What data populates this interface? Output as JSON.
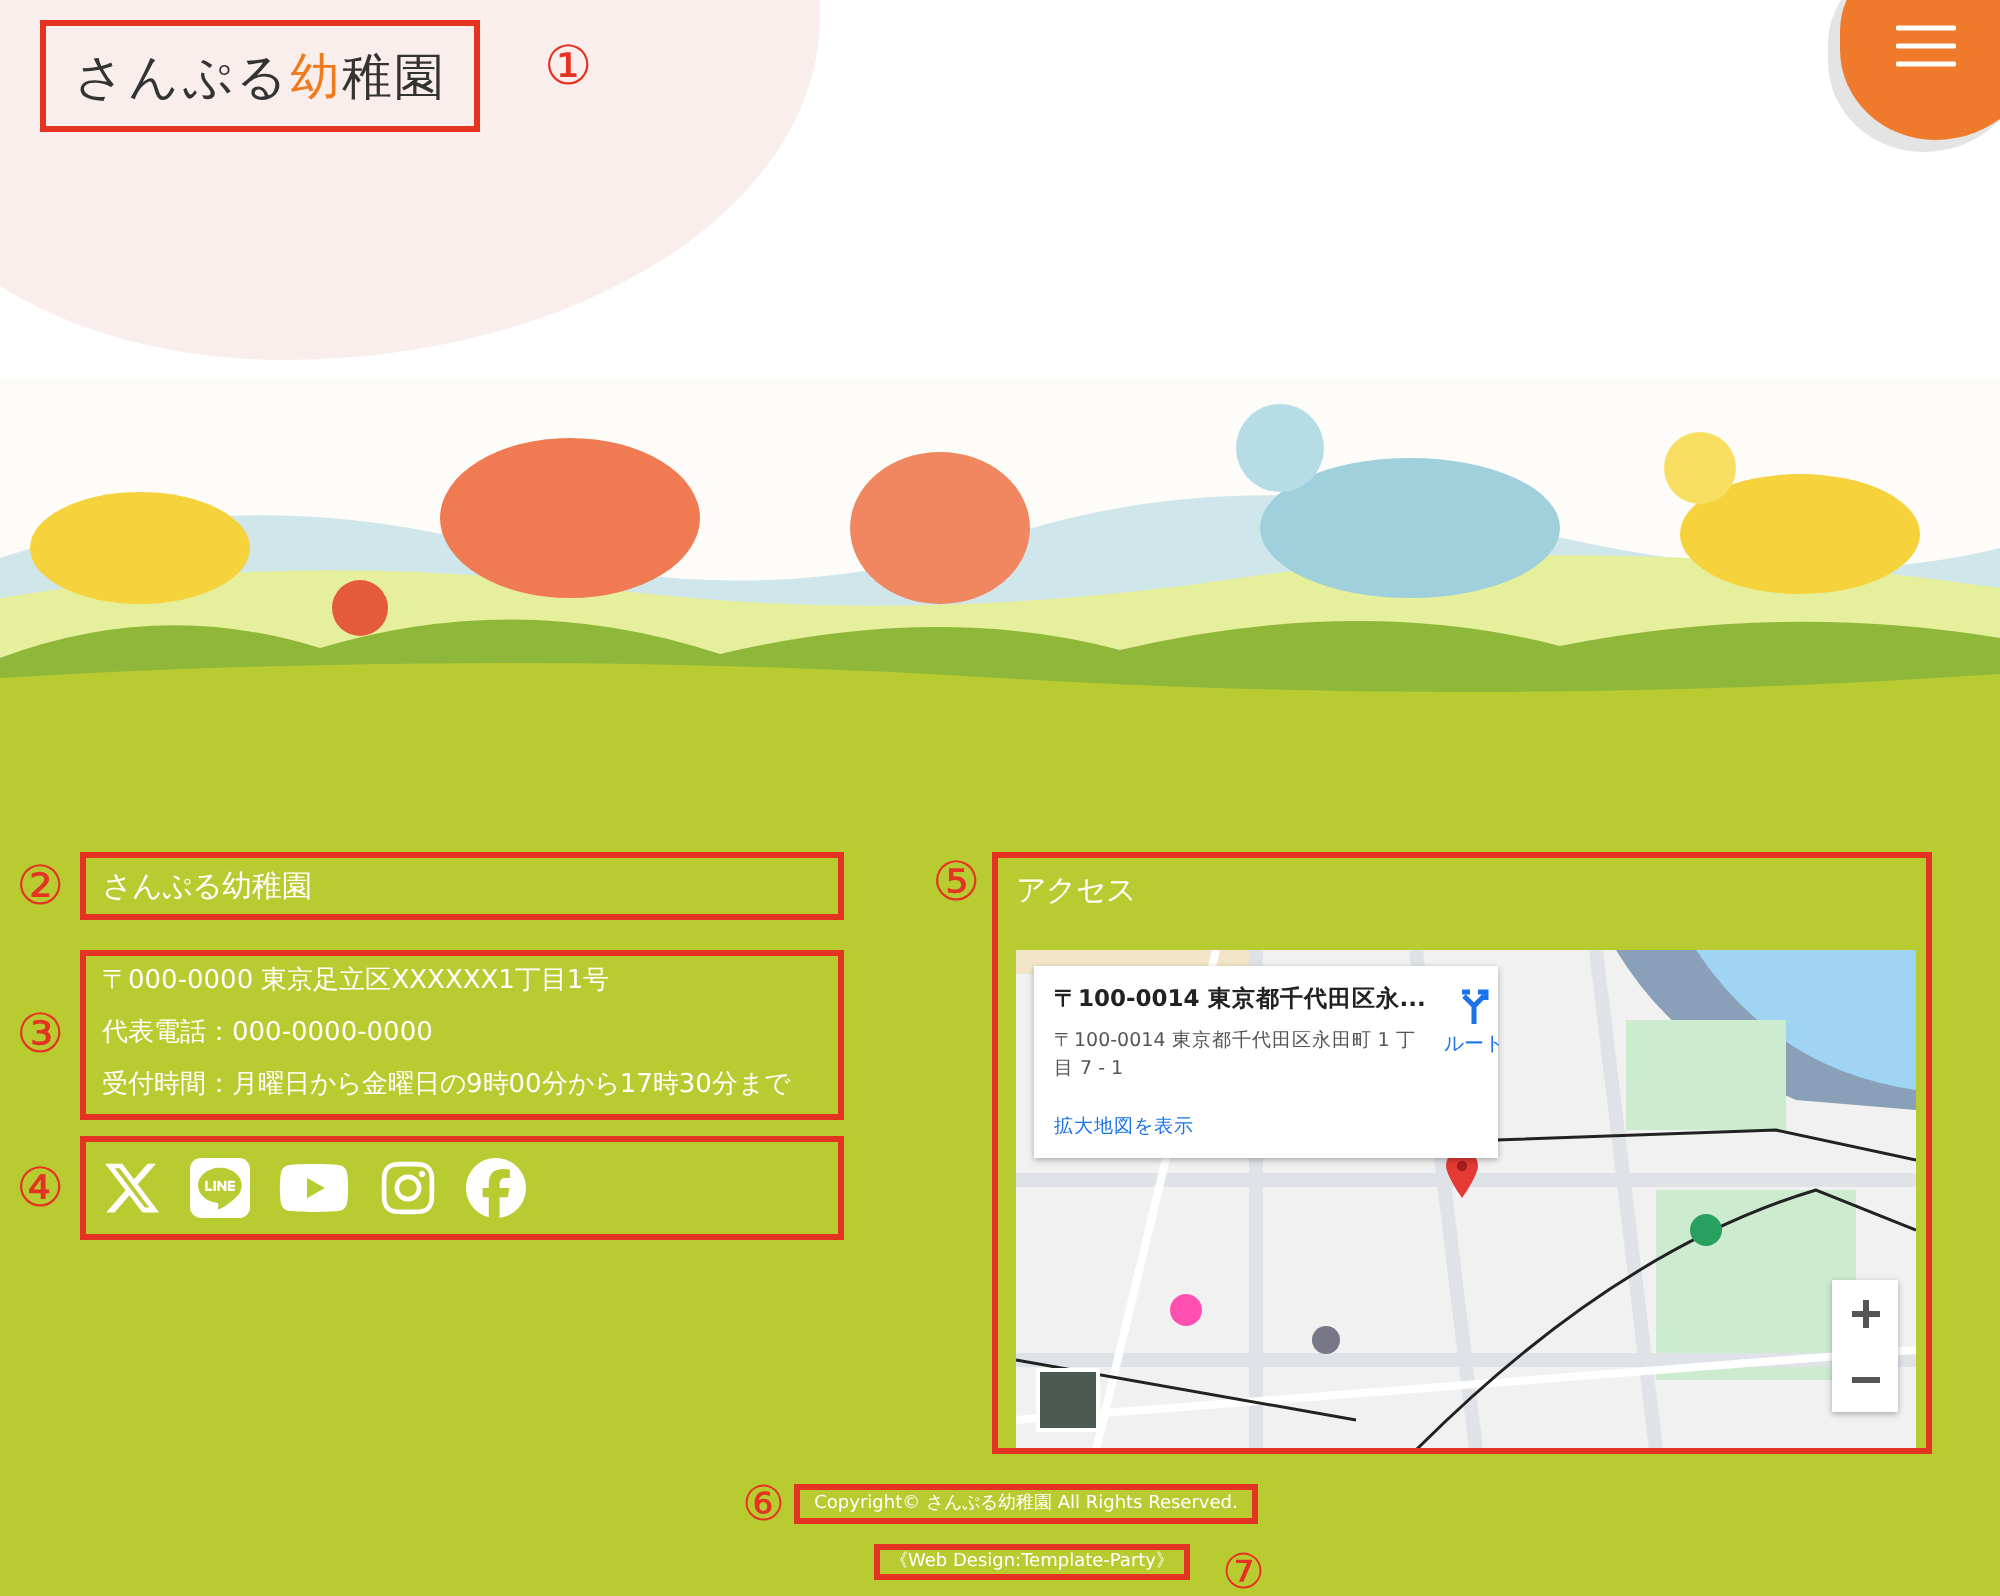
{
  "header": {
    "logo": {
      "before": "さんぷる",
      "accent": "幼",
      "after": "稚園"
    },
    "annotation": "①",
    "menu_button": {
      "kind": "hamburger"
    }
  },
  "school": {
    "name": "さんぷる幼稚園",
    "name_annotation": "②",
    "info_annotation": "③",
    "info_lines": [
      "〒000-0000 東京足立区XXXXXX1丁目1号",
      "代表電話：000-0000-0000",
      "受付時間：月曜日から金曜日の9時00分から17時30分まで"
    ],
    "social_annotation": "④",
    "social": [
      {
        "kind": "x"
      },
      {
        "kind": "line"
      },
      {
        "kind": "youtube"
      },
      {
        "kind": "instagram"
      },
      {
        "kind": "facebook"
      }
    ]
  },
  "access": {
    "annotation": "⑤",
    "title": "アクセス",
    "map": {
      "card_title": "〒100-0014 東京都千代田区永...",
      "card_address": "〒100-0014 東京都千代田区永田町 1 丁目 7 - 1",
      "card_link": "拡大地図を表示",
      "route_label": "ルート"
    }
  },
  "footer": {
    "copyright_annotation": "⑥",
    "copyright": "Copyright© さんぷる幼稚園 All Rights Reserved.",
    "credit": "《Web Design:Template-Party》",
    "credit_annotation": "⑦"
  }
}
